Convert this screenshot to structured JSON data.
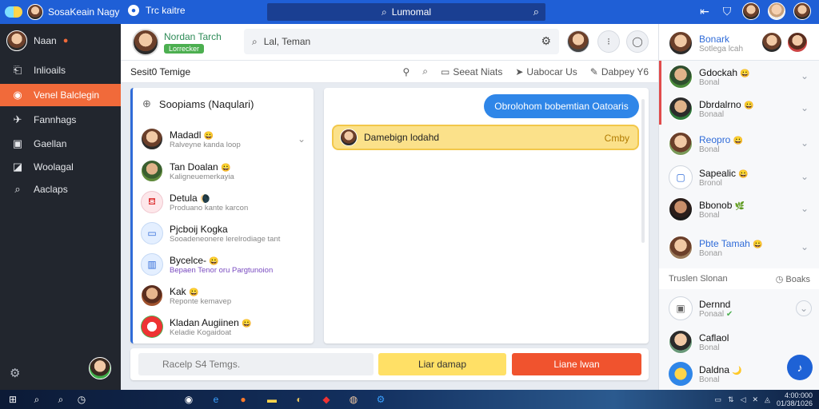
{
  "topbar": {
    "app_title": "SosaKeain Nagy",
    "context_label": "Trc kaitre",
    "search_label": "Lumomal",
    "icons": [
      "collapse-icon",
      "shield-icon",
      "user-avatar",
      "user-avatar",
      "user-avatar"
    ]
  },
  "leftnav": {
    "user_name": "Naan",
    "items": [
      {
        "label": "Inlioails",
        "icon": "inbox-icon"
      },
      {
        "label": "Venel Balclegin",
        "icon": "signal-icon"
      },
      {
        "label": "Fannhags",
        "icon": "compass-icon"
      },
      {
        "label": "Gaellan",
        "icon": "window-icon"
      },
      {
        "label": "Woolagal",
        "icon": "chart-icon"
      },
      {
        "label": "Aaclaps",
        "icon": "search-icon"
      }
    ]
  },
  "header": {
    "contact_name": "Nordan Tarch",
    "contact_status": "Lorrecker",
    "search_text": "Lal, Teman"
  },
  "subbar": {
    "title": "Sesit0 Temige",
    "tools": [
      "Seeat Niats",
      "Uabocar Us",
      "Dabpey Y6"
    ]
  },
  "conversations": {
    "header": "Soopiams (Naqulari)",
    "items": [
      {
        "name": "Madadl",
        "sub": "Ralveyne kanda loop",
        "emoji": "😀",
        "style": ""
      },
      {
        "name": "Tan Doalan",
        "sub": "Kaligneuemerkayia",
        "emoji": "😀",
        "style": ""
      },
      {
        "name": "Detula",
        "sub": "Produano kante karcon",
        "emoji": "🌘",
        "style": ""
      },
      {
        "name": "Pjcboij Kogka",
        "sub": "Sooadeneonere lerelrodiage tant",
        "emoji": "",
        "style": ""
      },
      {
        "name": "Bycelce-",
        "sub": "Bepaen Tenor oru Pargtunoion",
        "emoji": "😀",
        "style": "purple"
      },
      {
        "name": "Kak",
        "sub": "Reponte kemavep",
        "emoji": "😀",
        "style": ""
      },
      {
        "name": "Kladan Augiinen",
        "sub": "Keladie Kogaidoat",
        "emoji": "😀",
        "style": ""
      }
    ]
  },
  "chat": {
    "bubble_out": "Obrolohom bobemtian Oatoaris",
    "bubble_in": "Damebign lodahd",
    "bubble_in_tag": "Cmby"
  },
  "composer": {
    "placeholder": "Racelp S4 Temgs.",
    "primary_label": "Liar damap",
    "secondary_label": "Liane lwan"
  },
  "rightpanel": {
    "me_name": "Bonark",
    "me_sub": "Sotlega lcah",
    "contacts": [
      {
        "name": "Gdockah",
        "sub": "Bonal",
        "emoji": "😀",
        "selected": true,
        "blue": false
      },
      {
        "name": "Dbrdalrno",
        "sub": "Bonaal",
        "emoji": "😀",
        "selected": true,
        "blue": false
      },
      {
        "name": "Reopro",
        "sub": "Bonal",
        "emoji": "😀",
        "selected": false,
        "blue": true
      },
      {
        "name": "Sapealic",
        "sub": "Bronol",
        "emoji": "😀",
        "selected": false,
        "blue": false
      },
      {
        "name": "Bbonob",
        "sub": "Bonal",
        "emoji": "🌿",
        "selected": false,
        "blue": false
      },
      {
        "name": "Pbte Tamah",
        "sub": "Bonan",
        "emoji": "😀",
        "selected": false,
        "blue": true
      }
    ],
    "section_title": "Truslen Slonan",
    "section_action": "Boaks",
    "contacts2": [
      {
        "name": "Dernnd",
        "sub": "Ponaal",
        "emoji": "✔"
      },
      {
        "name": "Caflaol",
        "sub": "Bonal",
        "emoji": ""
      },
      {
        "name": "Daldna",
        "sub": "Bonal",
        "emoji": "🌙"
      }
    ]
  },
  "taskbar": {
    "clock": "4:00:000",
    "date": "01/38/1026"
  },
  "colors": {
    "accent": "#1f5fd6",
    "nav_active": "#f16a3a",
    "primary_button": "#ffe066",
    "danger_button": "#f0532e"
  }
}
